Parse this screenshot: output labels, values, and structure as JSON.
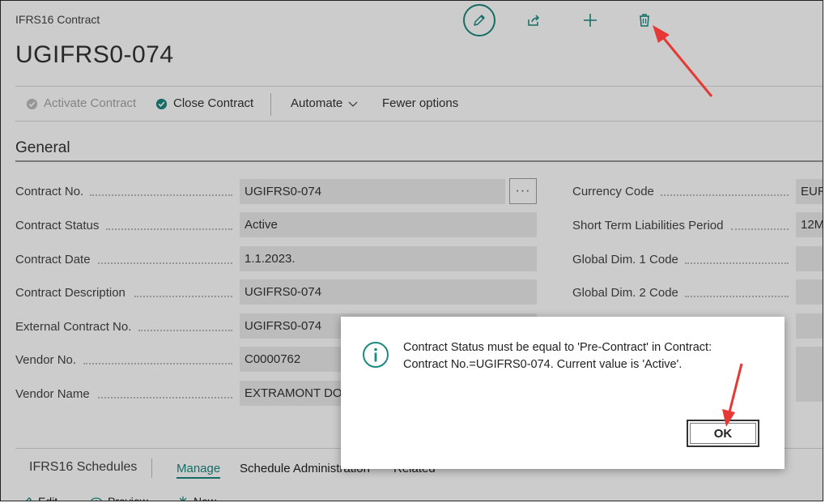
{
  "page": {
    "caption": "IFRS16 Contract",
    "title": "UGIFRS0-074"
  },
  "header_icons": [
    "pencil-icon",
    "share-icon",
    "plus-icon",
    "trash-icon"
  ],
  "actions": {
    "activate": "Activate Contract",
    "close": "Close Contract",
    "automate": "Automate",
    "fewer": "Fewer options"
  },
  "section": {
    "title": "General"
  },
  "fields_left": [
    {
      "label": "Contract No.",
      "value": "UGIFRS0-074"
    },
    {
      "label": "Contract Status",
      "value": "Active"
    },
    {
      "label": "Contract Date",
      "value": "1.1.2023."
    },
    {
      "label": "Contract Description",
      "value": "UGIFRS0-074"
    },
    {
      "label": "External Contract No.",
      "value": "UGIFRS0-074"
    },
    {
      "label": "Vendor No.",
      "value": "C0000762"
    },
    {
      "label": "Vendor Name",
      "value": "EXTRAMONT DOO"
    }
  ],
  "fields_right": [
    {
      "label": "Currency Code",
      "value": "EUR"
    },
    {
      "label": "Short Term Liabilities Period",
      "value": "12M"
    },
    {
      "label": "Global Dim. 1 Code",
      "value": ""
    },
    {
      "label": "Global Dim. 2 Code",
      "value": ""
    }
  ],
  "schedules": {
    "title": "IFRS16 Schedules",
    "tabs": [
      "Manage",
      "Schedule Administration",
      "Related"
    ],
    "actions": [
      "Edit",
      "Preview",
      "New"
    ]
  },
  "dialog": {
    "line1": "Contract Status must be equal to 'Pre-Contract' in Contract:",
    "line2": "Contract No.=UGIFRS0-074. Current value is 'Active'.",
    "ok_label": "OK"
  },
  "colors": {
    "accent": "#1b8a80",
    "annotation": "#e53935"
  }
}
